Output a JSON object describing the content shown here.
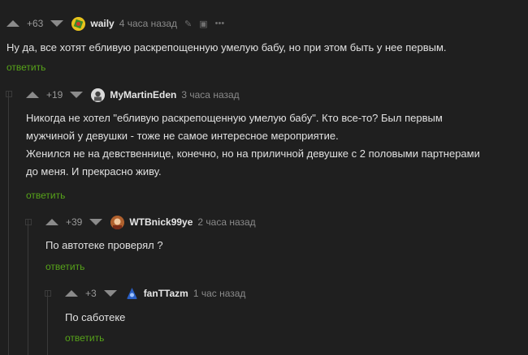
{
  "reply_label": "ответить",
  "comments": [
    {
      "rating": "+63",
      "user": "waily",
      "time": "4 часа назад",
      "lines": [
        "Ну да, все хотят ебливую раскрепощенную умелую бабу, но при этом быть у нее первым."
      ]
    },
    {
      "rating": "+19",
      "user": "MyMartinEden",
      "time": "3 часа назад",
      "lines": [
        "Никогда не хотел \"ебливую раскрепощенную умелую бабу\". Кто все-то? Был первым",
        "мужчиной у девушки - тоже не самое интересное мероприятие.",
        "Женился не на девственнице, конечно, но на приличной девушке с 2 половыми партнерами",
        "до меня. И прекрасно живу."
      ]
    },
    {
      "rating": "+39",
      "user": "WTBnick99ye",
      "time": "2 часа назад",
      "lines": [
        "По автотеке проверял ?"
      ]
    },
    {
      "rating": "+3",
      "user": "fanTTazm",
      "time": "1 час назад",
      "lines": [
        "По саботеке"
      ]
    }
  ],
  "colors": {
    "background": "#1f1f1f",
    "reply": "#57a31a",
    "text": "#e0e0e0",
    "muted": "#8a8a8a"
  }
}
